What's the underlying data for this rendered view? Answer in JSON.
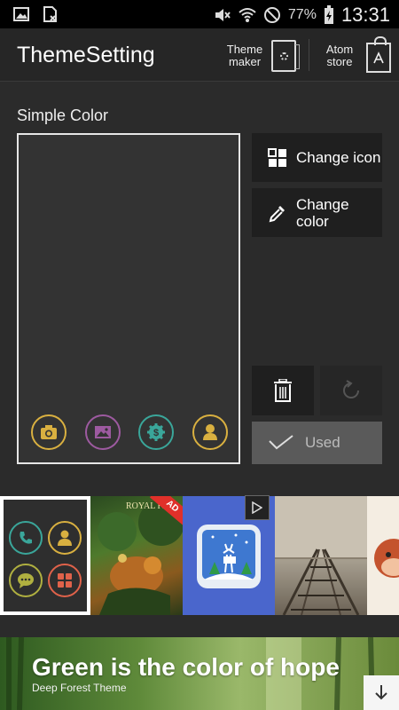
{
  "status_bar": {
    "battery": "77%",
    "time": "13:31",
    "icons": [
      "gallery-icon",
      "sim-icon",
      "mute-icon",
      "wifi-icon",
      "no-disturb-icon",
      "battery-icon"
    ]
  },
  "header": {
    "title": "ThemeSetting",
    "theme_maker_label_1": "Theme",
    "theme_maker_label_2": "maker",
    "atom_store_label_1": "Atom",
    "atom_store_label_2": "store"
  },
  "section": {
    "title": "Simple Color"
  },
  "preview": {
    "dock_icons": [
      "camera-icon",
      "gallery-icon",
      "settings-icon",
      "contact-icon"
    ]
  },
  "actions": {
    "change_icon": "Change icon",
    "change_color_1": "Change",
    "change_color_2": "color",
    "used": "Used"
  },
  "theme_strip": {
    "ad_badge": "AD",
    "royal_label": "ROYAL FL"
  },
  "banner": {
    "title": "Green is the color of hope",
    "subtitle": "Deep Forest Theme"
  },
  "colors": {
    "yellow": "#d9b040",
    "purple": "#9d5aa0",
    "teal": "#3aa69a",
    "green_call": "#3aa69a",
    "coral": "#e0624a"
  }
}
